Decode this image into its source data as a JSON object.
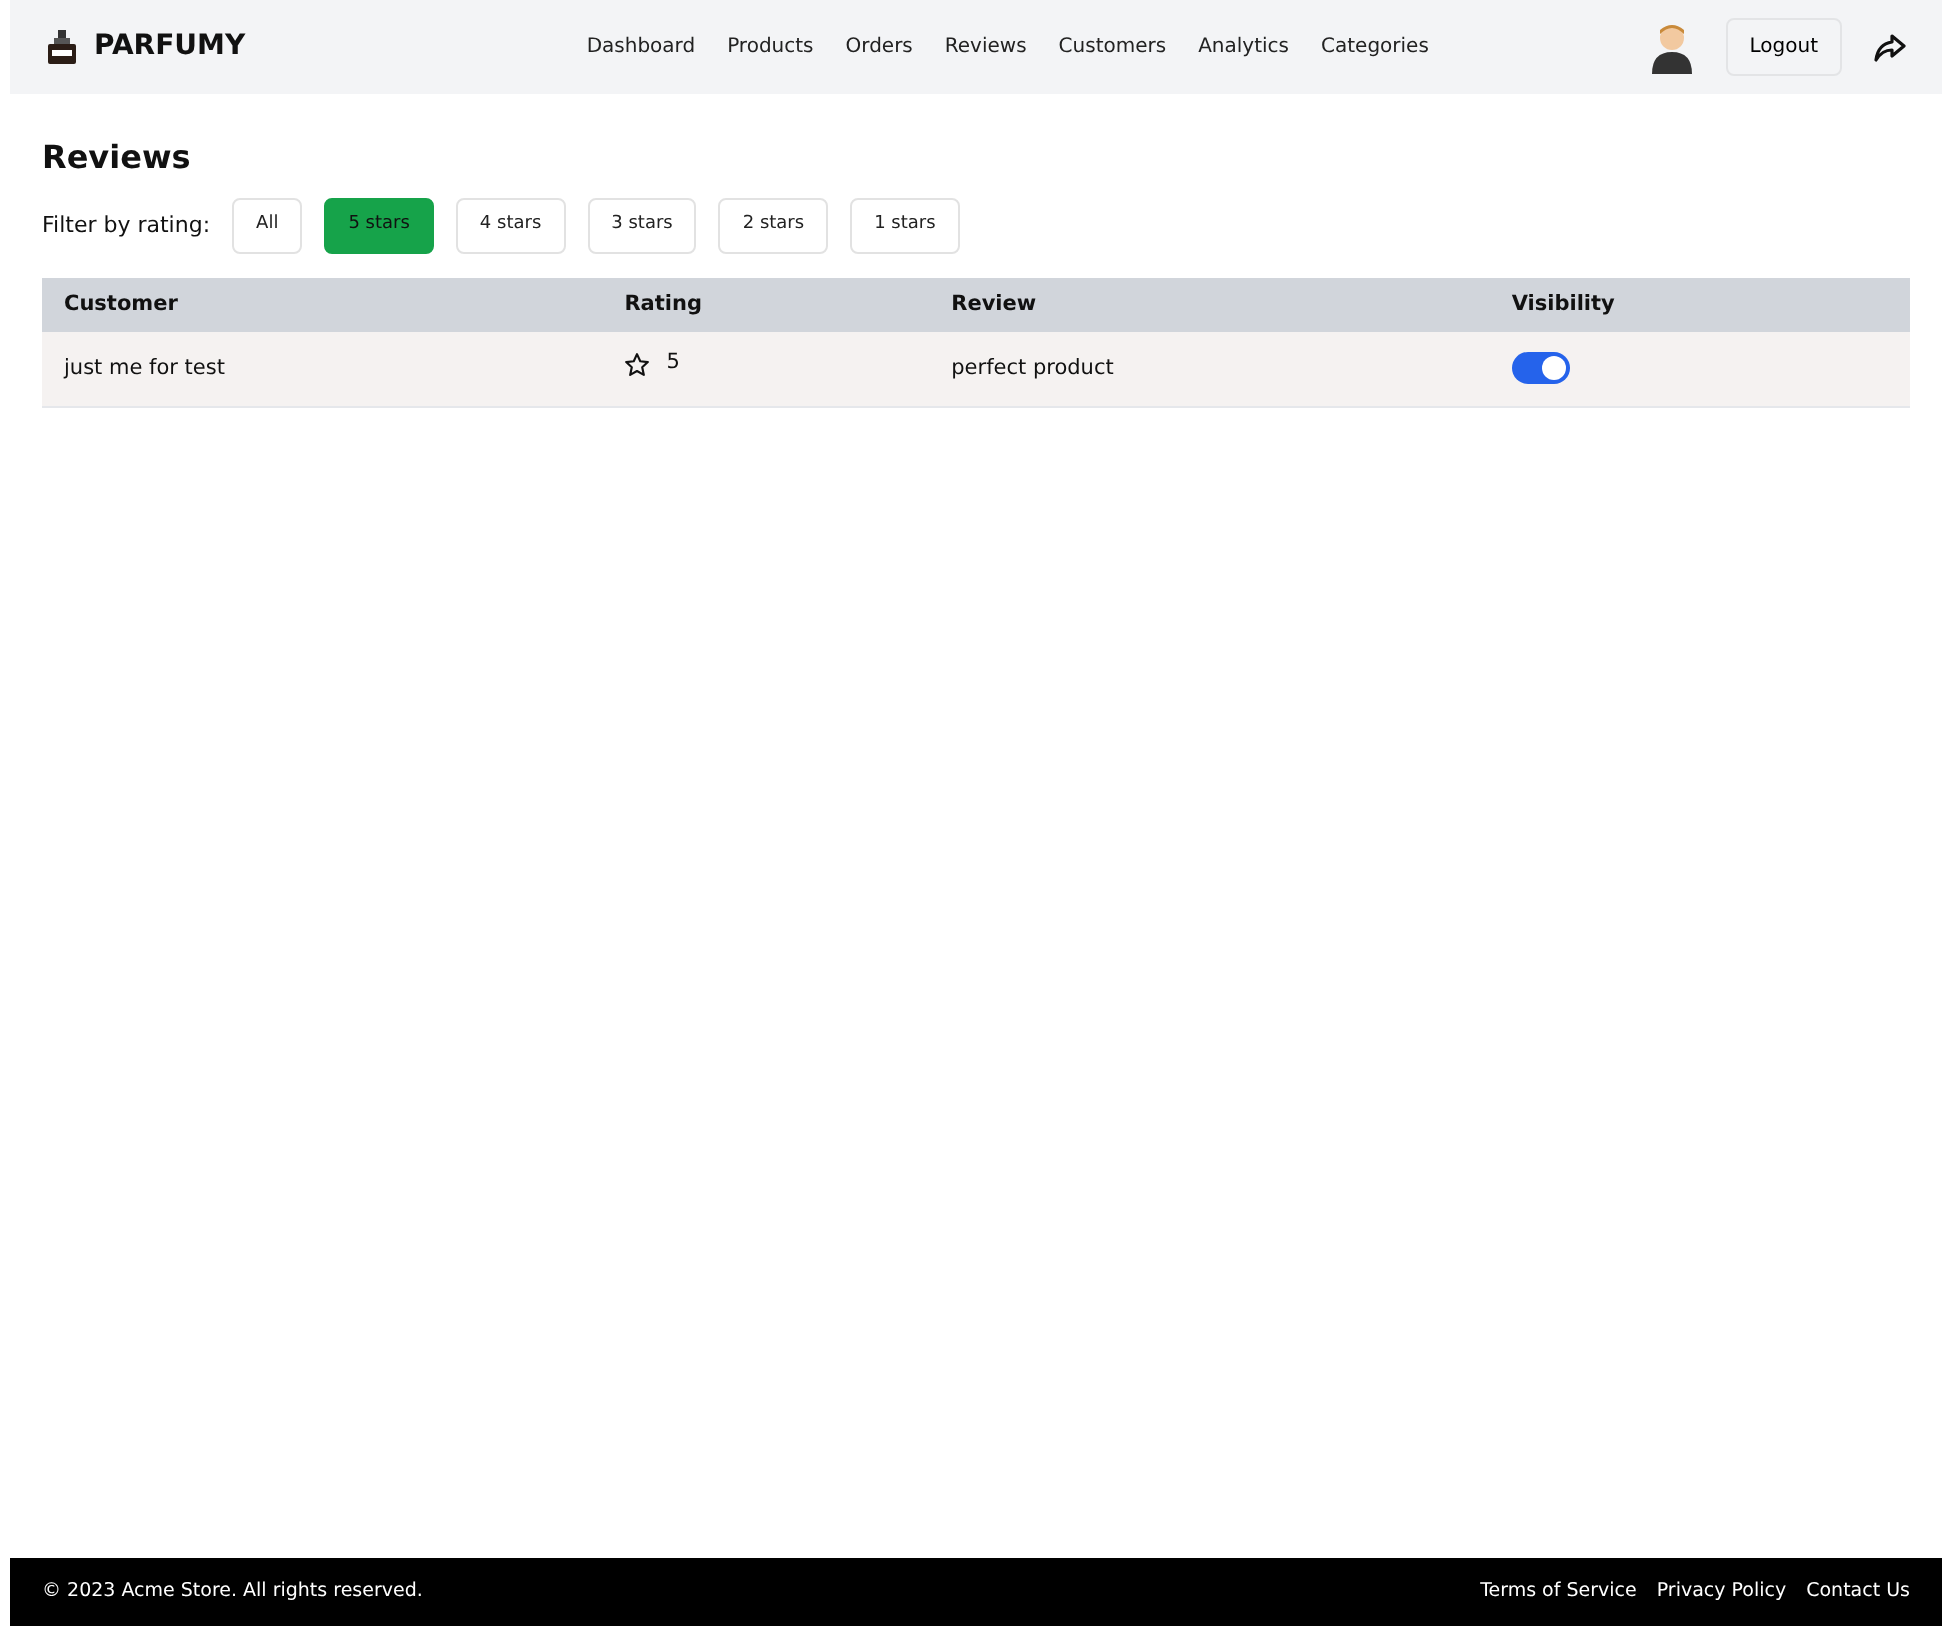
{
  "brand": "PARFUMY",
  "nav": [
    {
      "label": "Dashboard",
      "selected": false
    },
    {
      "label": "Products",
      "selected": false
    },
    {
      "label": "Orders",
      "selected": false
    },
    {
      "label": "Reviews",
      "selected": false
    },
    {
      "label": "Customers",
      "selected": false
    },
    {
      "label": "Analytics",
      "selected": false
    },
    {
      "label": "Categories",
      "selected": false
    }
  ],
  "logout": "Logout",
  "title": "Reviews",
  "filter_label": "Filter by rating:",
  "filters": [
    {
      "label": "All",
      "selected": false
    },
    {
      "label": "5 stars",
      "selected": true
    },
    {
      "label": "4 stars",
      "selected": false
    },
    {
      "label": "3 stars",
      "selected": false
    },
    {
      "label": "2 stars",
      "selected": false
    },
    {
      "label": "1 stars",
      "selected": false
    }
  ],
  "table": {
    "columns": [
      "Customer",
      "Rating",
      "Review",
      "Visibility"
    ],
    "rows": [
      {
        "customer": "just me for test",
        "rating": "5",
        "review": "perfect product",
        "visible": true
      }
    ]
  },
  "footer": {
    "copyright": "© 2023 Acme Store. All rights reserved.",
    "links": [
      "Terms of Service",
      "Privacy Policy",
      "Contact Us"
    ]
  }
}
